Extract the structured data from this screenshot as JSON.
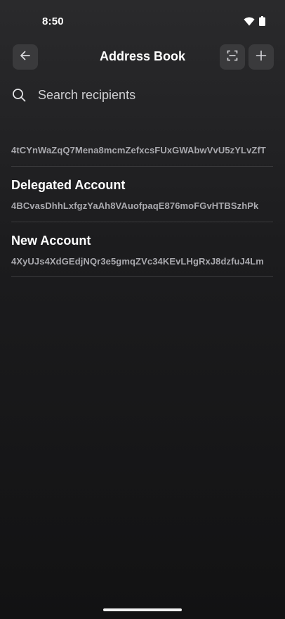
{
  "status_bar": {
    "time": "8:50"
  },
  "header": {
    "title": "Address Book",
    "back_icon": "arrow-left-icon",
    "scan_icon": "scan-icon",
    "add_icon": "plus-icon"
  },
  "search": {
    "placeholder": "Search recipients",
    "value": ""
  },
  "contacts": [
    {
      "name": "",
      "address": "4tCYnWaZqQ7Mena8mcmZefxcsFUxGWAbwVvU5zYLvZfT"
    },
    {
      "name": "Delegated Account",
      "address": "4BCvasDhhLxfgzYaAh8VAuofpaqE876moFGvHTBSzhPk"
    },
    {
      "name": "New Account",
      "address": "4XyUJs4XdGEdjNQr3e5gmqZVc34KEvLHgRxJ8dzfuJ4Lm"
    }
  ],
  "colors": {
    "background_top": "#2a2a2c",
    "background_bottom": "#121213",
    "button_bg": "#3a3a3c",
    "divider": "#3a3a3c",
    "secondary_text": "#a9a9ae"
  }
}
